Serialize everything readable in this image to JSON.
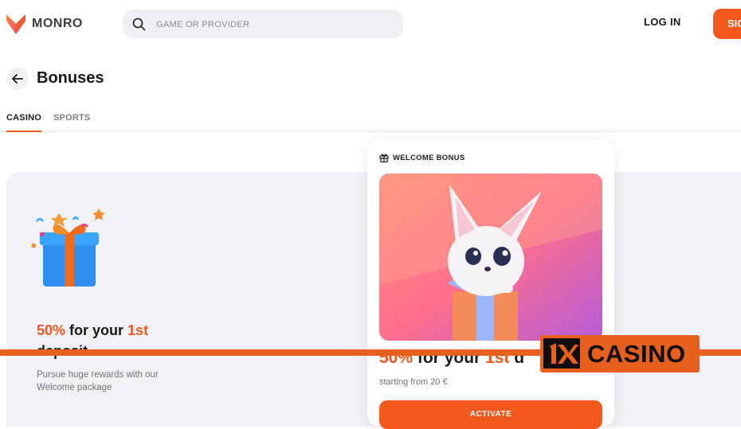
{
  "header": {
    "logo_text": "MONRO",
    "search_placeholder": "GAME OR PROVIDER",
    "login_label": "LOG IN",
    "signup_label": "SIG"
  },
  "page": {
    "title": "Bonuses"
  },
  "tabs": [
    {
      "label": "CASINO",
      "active": true
    },
    {
      "label": "SPORTS",
      "active": false
    }
  ],
  "promo": {
    "title_pct": "50%",
    "title_mid": " for your ",
    "title_ord": "1st",
    "title_end": " deposit",
    "description": "Pursue huge rewards with our Welcome package"
  },
  "card": {
    "label": "WELCOME BONUS",
    "title_pct": "50%",
    "title_mid": " for your ",
    "title_ord": "1st",
    "title_end": " d",
    "subtitle": "starting from 20 €",
    "button_label": "ACTIVATE"
  },
  "overlay": {
    "text": "CASINO"
  },
  "colors": {
    "accent": "#f2571c",
    "panel_bg": "#f1f2f5",
    "banner": "#e8601e"
  }
}
